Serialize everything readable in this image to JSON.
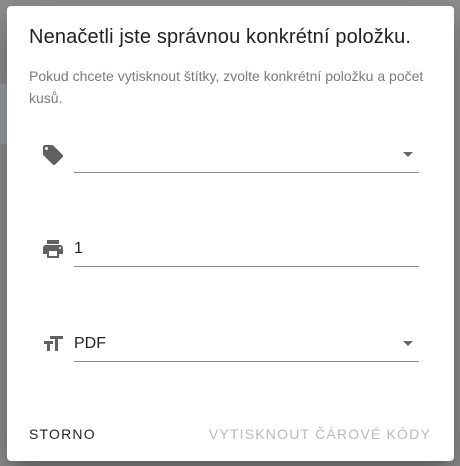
{
  "dialog": {
    "title": "Nenačetli jste správnou konkrétní položku.",
    "subtitle": "Pokud chcete vytisknout štítky, zvolte konkrétní položku a počet kusů."
  },
  "fields": {
    "item": {
      "icon": "tag-icon",
      "value": ""
    },
    "count": {
      "icon": "printer-icon",
      "value": "1"
    },
    "format": {
      "icon": "text-size-icon",
      "value": "PDF"
    }
  },
  "actions": {
    "cancel_label": "STORNO",
    "print_label": "VYTISKNOUT ČÁROVÉ KÓDY",
    "print_disabled": true
  },
  "colors": {
    "text": "#212121",
    "subtitle": "#7a7a7a",
    "disabled": "#b9b9b9",
    "icon": "#616161",
    "underline": "#8a8a8a"
  }
}
